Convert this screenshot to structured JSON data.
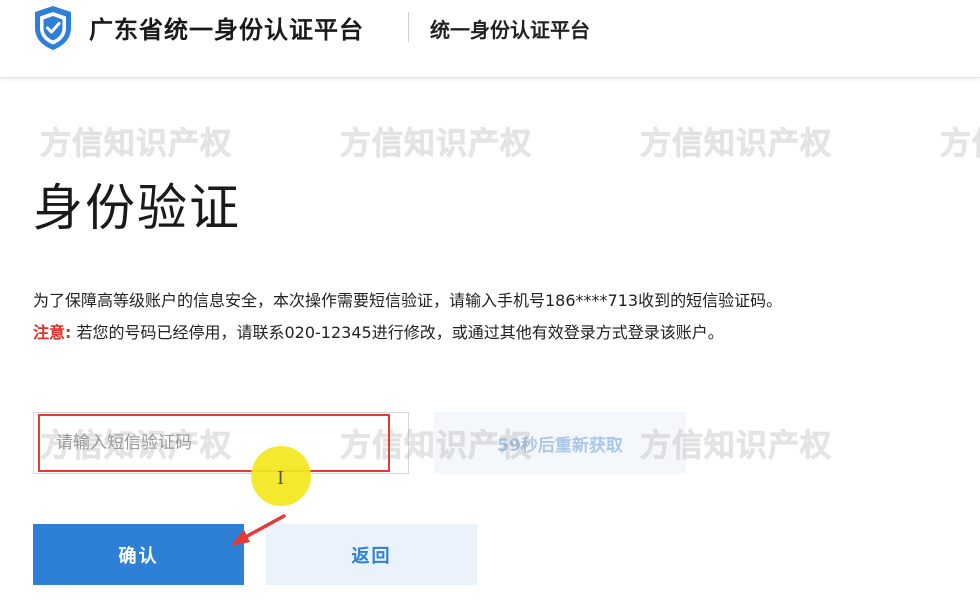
{
  "header": {
    "platform_name": "广东省统一身份认证平台",
    "platform_sub": "统一身份认证平台",
    "logo_icon": "shield-check-icon",
    "brand_color": "#2e7fd6"
  },
  "watermarks": [
    "方信知识产权",
    "方信知识产权",
    "方信知识产权",
    "方信知识产权",
    "方信知识产权",
    "方信知识产权",
    "方信知识产权"
  ],
  "main": {
    "title": "身份验证",
    "info_text": "为了保障高等级账户的信息安全，本次操作需要短信验证，请输入手机号186****713收到的短信验证码。",
    "notice_label": "注意:",
    "notice_text": " 若您的号码已经停用，请联系020-12345进行修改，或通过其他有效登录方式登录该账户。",
    "notice_color": "#e0312b"
  },
  "form": {
    "code_placeholder": "请输入短信验证码",
    "code_value": "",
    "resend_label": "59秒后重新获取",
    "confirm_label": "确认",
    "back_label": "返回"
  },
  "annotations": {
    "highlight_color": "#e53935",
    "cursor_color": "#f4e71e",
    "text_cursor": "I"
  }
}
